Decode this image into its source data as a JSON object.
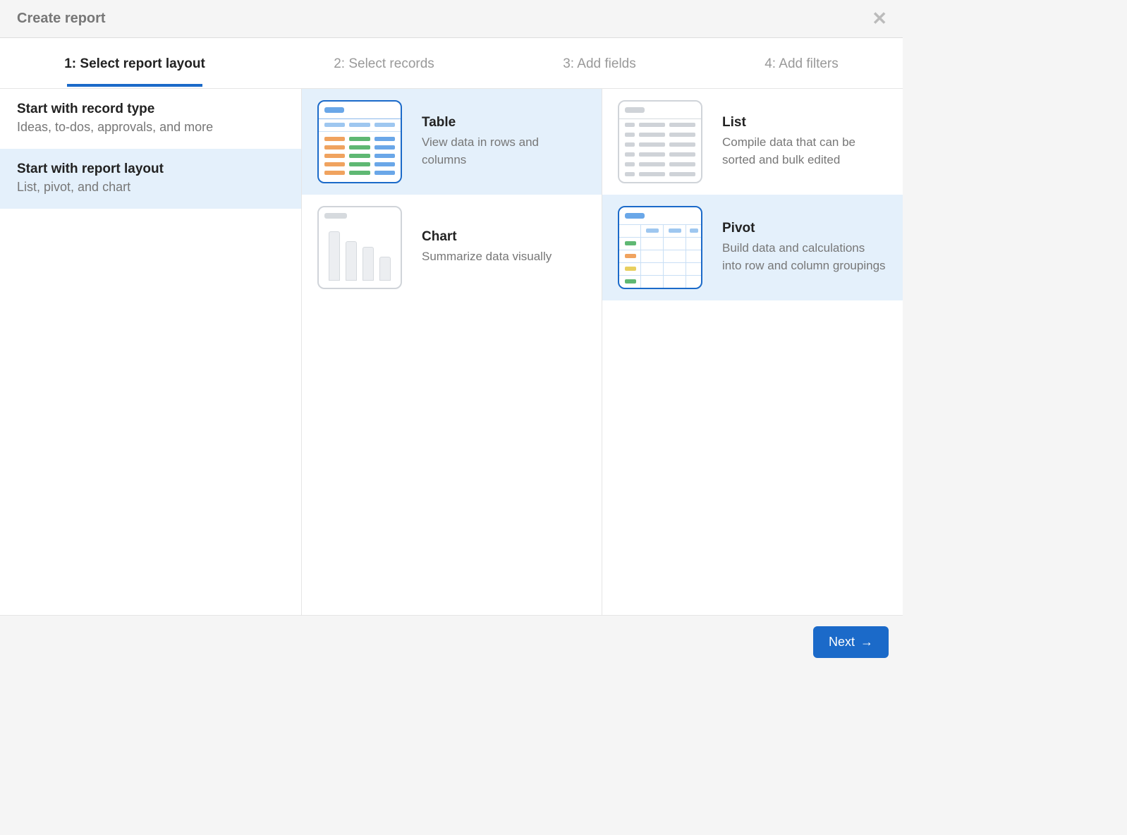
{
  "header": {
    "title": "Create report"
  },
  "steps": [
    {
      "label": "1: Select report layout",
      "active": true
    },
    {
      "label": "2: Select records",
      "active": false
    },
    {
      "label": "3: Add fields",
      "active": false
    },
    {
      "label": "4: Add filters",
      "active": false
    }
  ],
  "left_options": [
    {
      "title": "Start with record type",
      "subtitle": "Ideas, to-dos, approvals, and more",
      "selected": false
    },
    {
      "title": "Start with report layout",
      "subtitle": "List, pivot, and chart",
      "selected": true
    }
  ],
  "layouts": {
    "table": {
      "title": "Table",
      "desc": "View data in rows and columns",
      "highlighted": true
    },
    "list": {
      "title": "List",
      "desc": "Compile data that can be sorted and bulk edited",
      "highlighted": false
    },
    "chart": {
      "title": "Chart",
      "desc": "Summarize data visually",
      "highlighted": false
    },
    "pivot": {
      "title": "Pivot",
      "desc": "Build data and calculations into row and column groupings",
      "highlighted": true,
      "selected": true
    }
  },
  "footer": {
    "next_label": "Next"
  }
}
